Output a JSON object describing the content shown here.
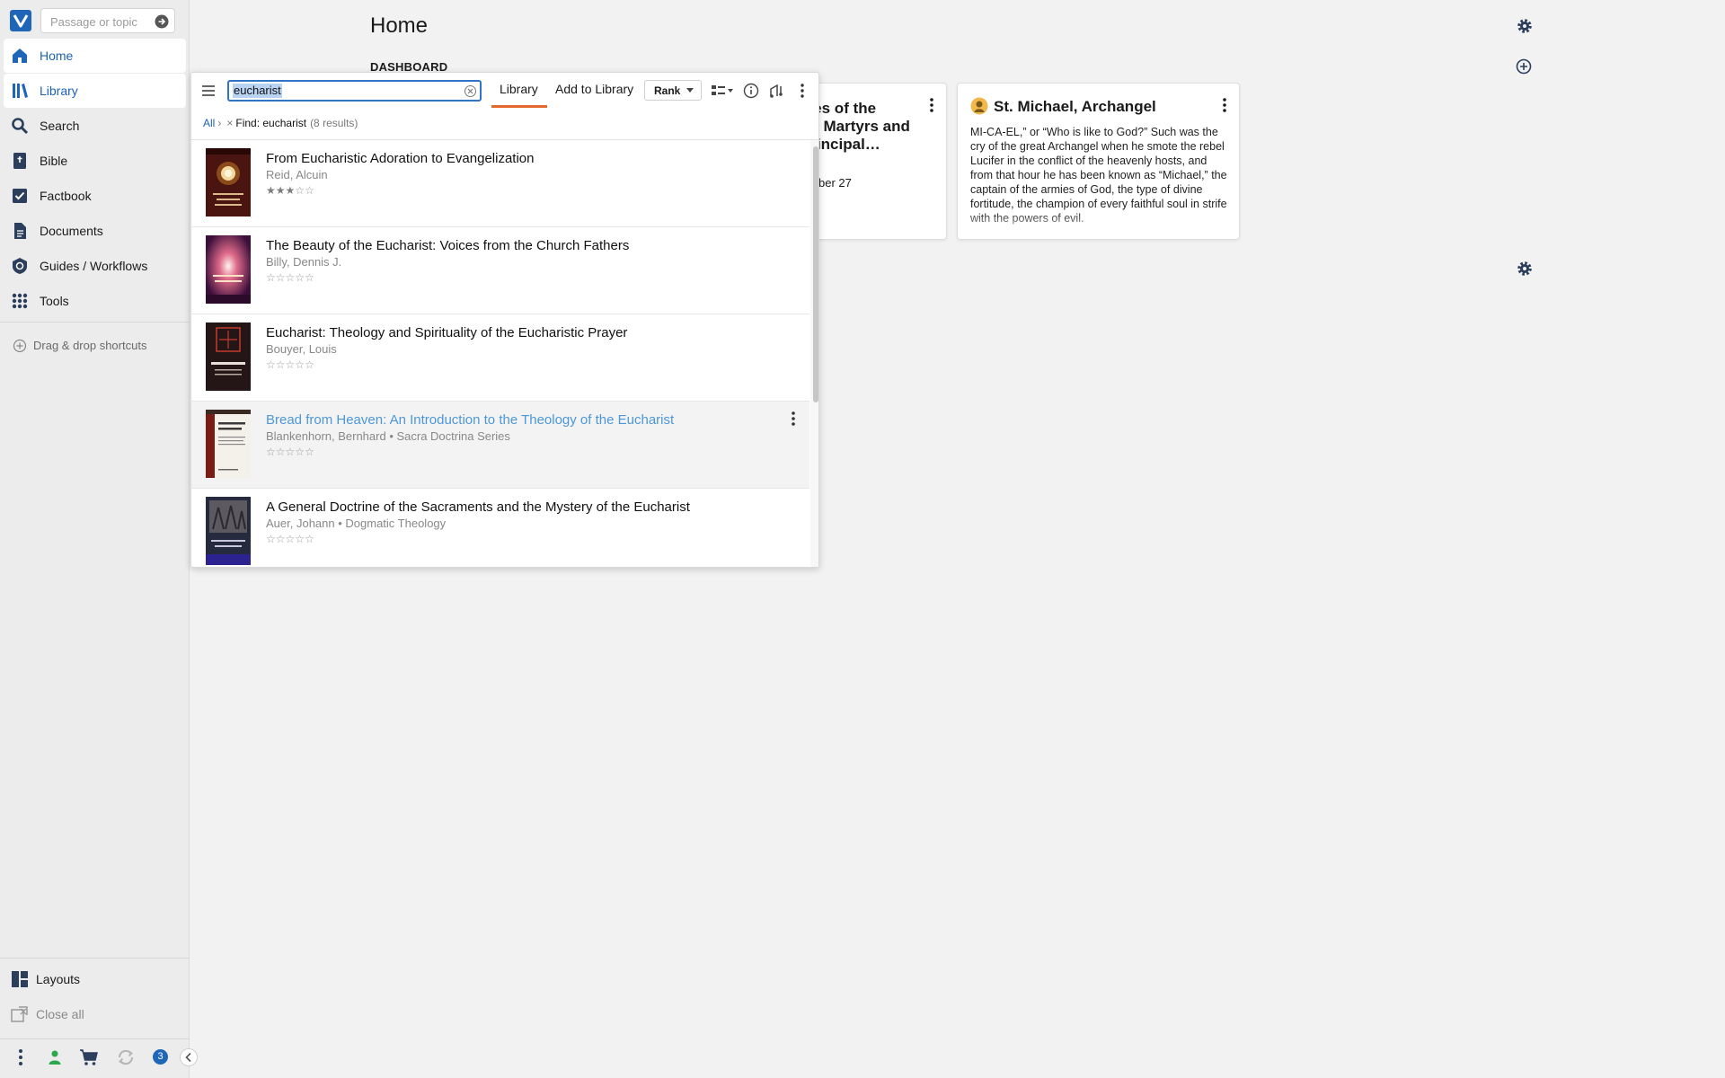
{
  "sidebar": {
    "passage_placeholder": "Passage or topic",
    "nav": [
      {
        "label": "Home",
        "icon": "home-icon"
      },
      {
        "label": "Library",
        "icon": "library-icon"
      },
      {
        "label": "Search",
        "icon": "search-icon"
      },
      {
        "label": "Bible",
        "icon": "bible-icon"
      },
      {
        "label": "Factbook",
        "icon": "factbook-icon"
      },
      {
        "label": "Documents",
        "icon": "documents-icon"
      },
      {
        "label": "Guides / Workflows",
        "icon": "guides-icon"
      },
      {
        "label": "Tools",
        "icon": "tools-grid-icon"
      }
    ],
    "shortcuts_hint": "Drag & drop shortcuts",
    "layouts_label": "Layouts",
    "close_all_label": "Close all",
    "notification_count": "3"
  },
  "home": {
    "title": "Home",
    "dashboard_label": "DASHBOARD",
    "cards": {
      "saints": {
        "title_partial": "ives of the\nrs, Martyrs and\nPrincipal…",
        "date_partial": "ber 27"
      },
      "michael": {
        "title": "St. Michael, Archangel",
        "body": "MI-CA-EL,” or “Who is like to God?” Such was the cry of the great Archangel when he smote the rebel Lucifer in the conflict of the heavenly hosts, and from that hour he has been known as “Michael,” the captain of the armies of God, the type of divine fortitude, the champion of every faithful soul in strife with the powers of evil."
      }
    }
  },
  "library": {
    "search_value": "eucharist",
    "tabs": {
      "library": "Library",
      "add": "Add to Library"
    },
    "sort_label": "Rank",
    "breadcrumb": {
      "all": "All",
      "sep": "›",
      "remove": "×",
      "find": "Find: eucharist",
      "count": "(8 results)"
    },
    "results": [
      {
        "title": "From Eucharistic Adoration to Evangelization",
        "author": "Reid, Alcuin",
        "rating": 3
      },
      {
        "title": "The Beauty of the Eucharist: Voices from the Church Fathers",
        "author": "Billy, Dennis J.",
        "rating": 0
      },
      {
        "title": "Eucharist: Theology and Spirituality of the Eucharistic Prayer",
        "author": "Bouyer, Louis",
        "rating": 0
      },
      {
        "title": "Bread from Heaven: An Introduction to the Theology of the Eucharist",
        "author": "Blankenhorn, Bernhard • Sacra Doctrina Series",
        "rating": 0
      },
      {
        "title": "A General Doctrine of the Sacraments and the Mystery of the Eucharist",
        "author": "Auer, Johann • Dogmatic Theology",
        "rating": 0
      }
    ]
  },
  "colors": {
    "accent_blue": "#1f65b8",
    "tab_underline": "#e2692b",
    "hover_title": "#4d97d9"
  }
}
